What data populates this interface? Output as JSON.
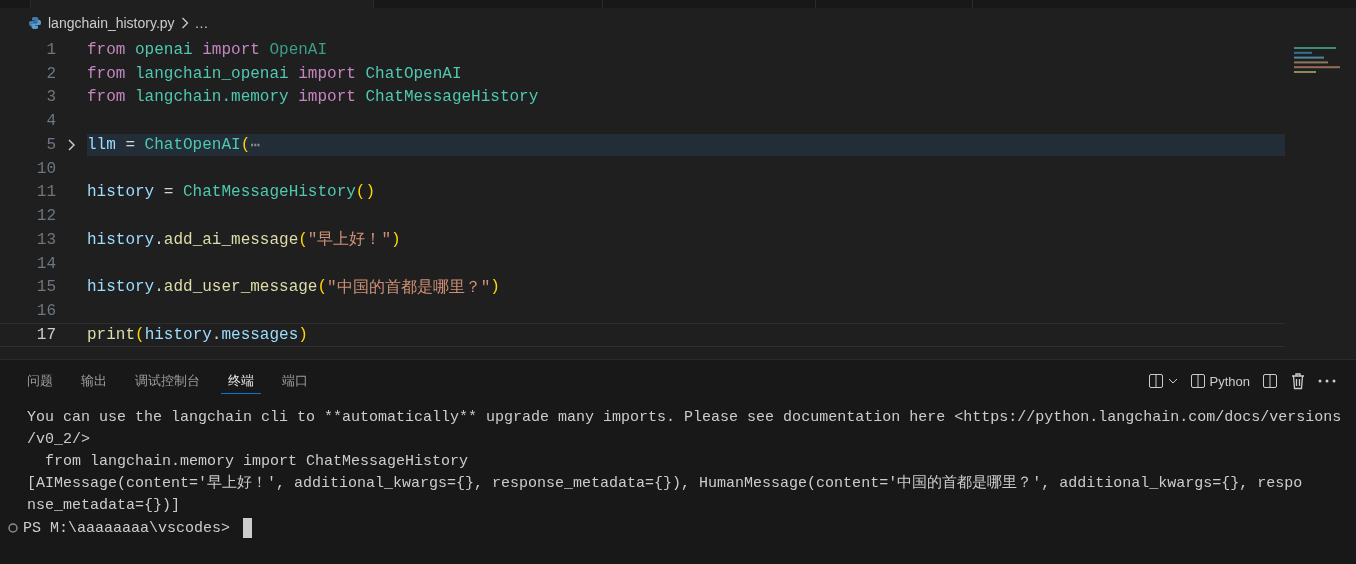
{
  "editor": {
    "breadcrumb": {
      "file": "langchain_history.py",
      "more": "…"
    },
    "lines": [
      {
        "number": "1",
        "current": false,
        "folded": false,
        "tokens": [
          {
            "kind": "keyword",
            "text": "from "
          },
          {
            "kind": "module",
            "text": "openai "
          },
          {
            "kind": "keyword",
            "text": "import "
          },
          {
            "kind": "class-dim",
            "text": "OpenAI"
          }
        ]
      },
      {
        "number": "2",
        "current": false,
        "folded": false,
        "tokens": [
          {
            "kind": "keyword",
            "text": "from "
          },
          {
            "kind": "module",
            "text": "langchain_openai "
          },
          {
            "kind": "keyword",
            "text": "import "
          },
          {
            "kind": "class",
            "text": "ChatOpenAI"
          }
        ]
      },
      {
        "number": "3",
        "current": false,
        "folded": false,
        "tokens": [
          {
            "kind": "keyword",
            "text": "from "
          },
          {
            "kind": "module",
            "text": "langchain.memory "
          },
          {
            "kind": "keyword",
            "text": "import "
          },
          {
            "kind": "class",
            "text": "ChatMessageHistory"
          }
        ]
      },
      {
        "number": "4",
        "current": false,
        "folded": false
      },
      {
        "number": "5",
        "current": false,
        "folded": true,
        "tokens": [
          {
            "kind": "variable",
            "text": "llm "
          },
          {
            "kind": "plain",
            "text": "= "
          },
          {
            "kind": "class",
            "text": "ChatOpenAI"
          },
          {
            "kind": "paren",
            "text": "("
          },
          {
            "kind": "ellipsis",
            "text": "⋯"
          }
        ]
      },
      {
        "number": "10",
        "current": false,
        "folded": false
      },
      {
        "number": "11",
        "current": false,
        "folded": false,
        "tokens": [
          {
            "kind": "variable",
            "text": "history "
          },
          {
            "kind": "plain",
            "text": "= "
          },
          {
            "kind": "class",
            "text": "ChatMessageHistory"
          },
          {
            "kind": "paren",
            "text": "()"
          }
        ]
      },
      {
        "number": "12",
        "current": false,
        "folded": false
      },
      {
        "number": "13",
        "current": false,
        "folded": false,
        "tokens": [
          {
            "kind": "variable",
            "text": "history"
          },
          {
            "kind": "plain",
            "text": "."
          },
          {
            "kind": "function",
            "text": "add_ai_message"
          },
          {
            "kind": "paren",
            "text": "("
          },
          {
            "kind": "string",
            "text": "\"早上好！\""
          },
          {
            "kind": "paren",
            "text": ")"
          }
        ]
      },
      {
        "number": "14",
        "current": false,
        "folded": false
      },
      {
        "number": "15",
        "current": false,
        "folded": false,
        "tokens": [
          {
            "kind": "variable",
            "text": "history"
          },
          {
            "kind": "plain",
            "text": "."
          },
          {
            "kind": "function",
            "text": "add_user_message"
          },
          {
            "kind": "paren",
            "text": "("
          },
          {
            "kind": "string",
            "text": "\"中国的首都是哪里？\""
          },
          {
            "kind": "paren",
            "text": ")"
          }
        ]
      },
      {
        "number": "16",
        "current": false,
        "folded": false
      },
      {
        "number": "17",
        "current": true,
        "folded": false,
        "tokens": [
          {
            "kind": "function",
            "text": "print"
          },
          {
            "kind": "paren",
            "text": "("
          },
          {
            "kind": "variable",
            "text": "history"
          },
          {
            "kind": "plain",
            "text": "."
          },
          {
            "kind": "variable",
            "text": "messages"
          },
          {
            "kind": "paren",
            "text": ")"
          }
        ]
      }
    ]
  },
  "panel": {
    "tabs": [
      {
        "label": "问题",
        "selected": false
      },
      {
        "label": "输出",
        "selected": false
      },
      {
        "label": "调试控制台",
        "selected": false
      },
      {
        "label": "终端",
        "selected": true
      },
      {
        "label": "端口",
        "selected": false
      }
    ],
    "terminal_name": "Python",
    "terminal_lines": [
      "You can use the langchain cli to **automatically** upgrade many imports. Please see documentation here <https://python.langchain.com/docs/versions",
      "/v0_2/>",
      "  from langchain.memory import ChatMessageHistory",
      "[AIMessage(content='早上好！', additional_kwargs={}, response_metadata={}), HumanMessage(content='中国的首都是哪里？', additional_kwargs={}, respo",
      "nse_metadata={})]"
    ],
    "prompt": "PS M:\\aaaaaaaa\\vscodes>"
  }
}
